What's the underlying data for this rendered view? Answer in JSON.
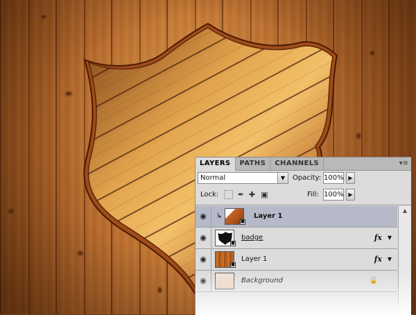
{
  "panel": {
    "tabs": [
      {
        "label": "LAYERS",
        "active": true
      },
      {
        "label": "PATHS",
        "active": false
      },
      {
        "label": "CHANNELS",
        "active": false
      }
    ],
    "menu_icon": "panel-menu-icon",
    "blend_mode": "Normal",
    "opacity_label": "Opacity:",
    "opacity_value": "100%",
    "lock_label": "Lock:",
    "fill_label": "Fill:",
    "fill_value": "100%",
    "layers": [
      {
        "name": "Layer 1",
        "selected": true,
        "thumb": "wood-badge",
        "clipped": true,
        "fx": ""
      },
      {
        "name": "badge",
        "selected": false,
        "thumb": "badge",
        "clipped": false,
        "fx": "fx"
      },
      {
        "name": "Layer 1",
        "selected": false,
        "thumb": "wood",
        "clipped": false,
        "fx": "fx"
      },
      {
        "name": "Background",
        "selected": false,
        "thumb": "background",
        "clipped": false,
        "fx": "",
        "locked": true
      }
    ]
  },
  "colors": {
    "wood_dark": "#7a3f14",
    "wood_light": "#d88a3e",
    "badge_outline": "#5a2308",
    "selection": "#b5b9c8"
  }
}
